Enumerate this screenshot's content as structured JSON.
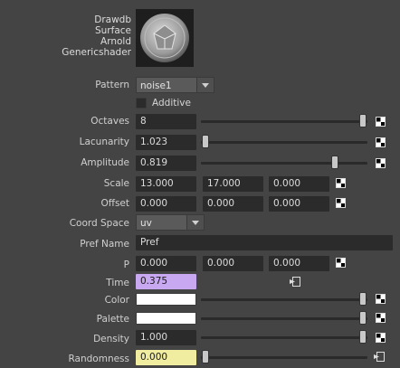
{
  "swatch": {
    "title_lines": [
      "Drawdb",
      "Surface",
      "Arnold",
      "Genericshader"
    ]
  },
  "pattern": {
    "label": "Pattern",
    "value": "noise1"
  },
  "additive": {
    "label": "Additive",
    "checked": false
  },
  "rows": {
    "octaves": {
      "label": "Octaves",
      "value": "8",
      "slider_fraction": 0.97
    },
    "lacunarity": {
      "label": "Lacunarity",
      "value": "1.023",
      "slider_fraction": 0.02
    },
    "amplitude": {
      "label": "Amplitude",
      "value": "0.819",
      "slider_fraction": 0.82
    }
  },
  "scale": {
    "label": "Scale",
    "values": [
      "13.000",
      "17.000",
      "0.000"
    ]
  },
  "offset": {
    "label": "Offset",
    "values": [
      "0.000",
      "0.000",
      "0.000"
    ]
  },
  "coord_space": {
    "label": "Coord Space",
    "value": "uv"
  },
  "pref_name": {
    "label": "Pref Name",
    "value": "Pref"
  },
  "p": {
    "label": "P",
    "values": [
      "0.000",
      "0.000",
      "0.000"
    ]
  },
  "time": {
    "label": "Time",
    "value": "0.375",
    "highlight_color": "#c8a8f0"
  },
  "color": {
    "label": "Color",
    "swatch_color": "#ffffff",
    "slider_fraction": 0.98
  },
  "palette": {
    "label": "Palette",
    "swatch_color": "#ffffff",
    "slider_fraction": 0.98
  },
  "density": {
    "label": "Density",
    "value": "1.000",
    "slider_fraction": 0.98
  },
  "randomness": {
    "label": "Randomness",
    "value": "0.000",
    "highlight_color": "#f0eca0",
    "slider_fraction": 0.0
  }
}
